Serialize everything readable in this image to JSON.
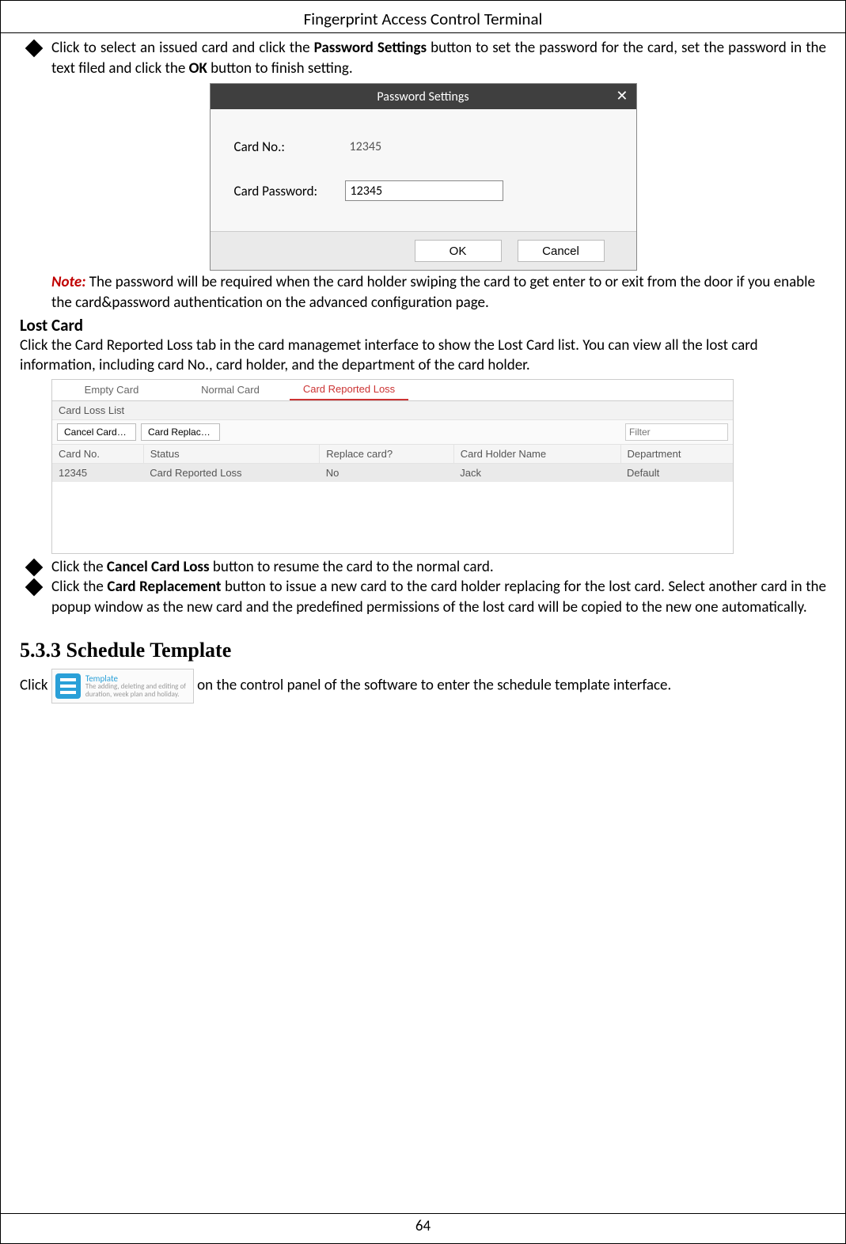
{
  "header": {
    "title": "Fingerprint Access Control Terminal"
  },
  "bullet1": {
    "pre": "Click to select an issued card and click the ",
    "bold1": "Password Settings",
    "mid": " button to set the password for the card, set the password in the text filed and click the ",
    "bold2": "OK",
    "post": " button to finish setting."
  },
  "dialog": {
    "title": "Password Settings",
    "close": "✕",
    "card_no_label": "Card No.:",
    "card_no_value": "12345",
    "card_pwd_label": "Card Password:",
    "card_pwd_value": "12345",
    "ok": "OK",
    "cancel": "Cancel"
  },
  "note": {
    "label": "Note:",
    "text": " The password will be required when the card holder swiping the card to get enter to or exit from the door if you enable the card&password authentication on the advanced configuration page."
  },
  "lost_card": {
    "heading": "Lost Card",
    "para": "Click the Card Reported Loss tab in the card managemet interface to show the Lost Card list. You can view all the lost card information, including card No., card holder, and the department of the card holder."
  },
  "card_loss_fig": {
    "tabs": [
      "Empty Card",
      "Normal Card",
      "Card Reported Loss"
    ],
    "active_tab_index": 2,
    "list_title": "Card Loss List",
    "btn_cancel": "Cancel Card L...",
    "btn_replace": "Card Replace ...",
    "filter_placeholder": "Filter",
    "columns": [
      "Card No.",
      "Status",
      "Replace card?",
      "Card Holder Name",
      "Department"
    ],
    "row": [
      "12345",
      "Card Reported Loss",
      "No",
      "Jack",
      "Default"
    ]
  },
  "bullet2": {
    "pre": "Click the ",
    "bold": "Cancel Card Loss",
    "post": " button to resume the card to the normal card."
  },
  "bullet3": {
    "pre": "Click the ",
    "bold": "Card Replacement",
    "post": " button to issue a new card to the card holder replacing for the lost card. Select another card in the popup window as the new card and the predefined permissions of the lost card will be copied to the new one automatically."
  },
  "section_heading": "5.3.3   Schedule Template",
  "template_line": {
    "pre": "Click ",
    "btn_title": "Template",
    "btn_desc": "The adding, deleting and editing of duration, week plan and holiday.",
    "post": " on the control panel of the software to enter the schedule template interface."
  },
  "footer": {
    "page": "64"
  }
}
